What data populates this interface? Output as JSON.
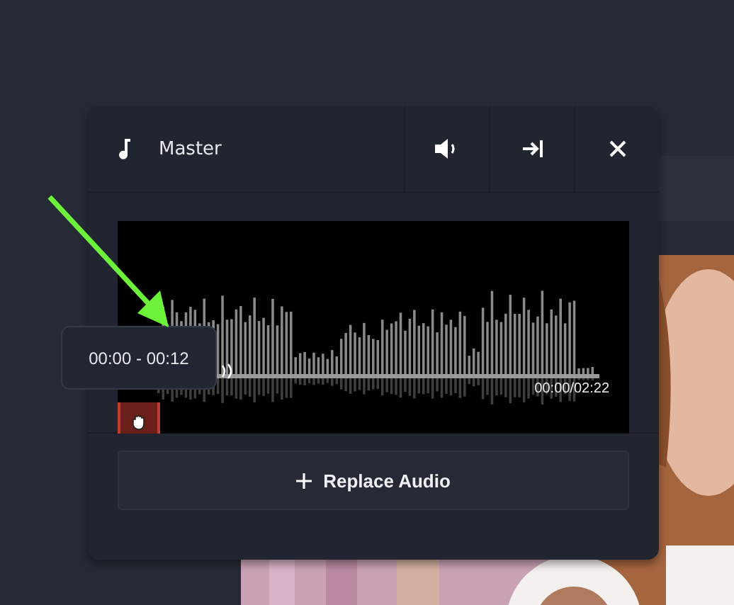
{
  "panel": {
    "title": "Master"
  },
  "waveform": {
    "time": "00:00/02:22"
  },
  "tooltip": {
    "text": "00:00 - 00:12"
  },
  "replace_button": {
    "label": "Replace Audio"
  }
}
